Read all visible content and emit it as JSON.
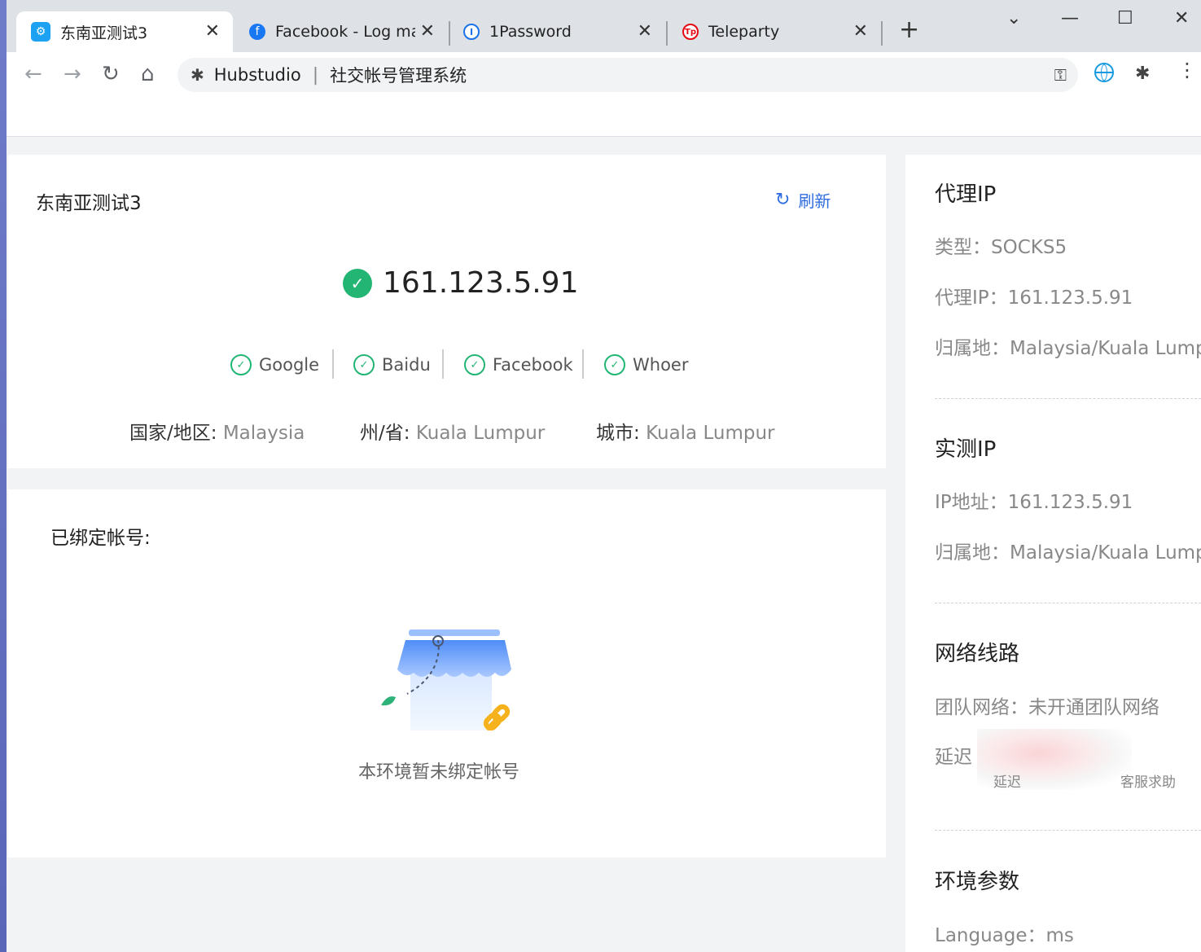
{
  "browser": {
    "tabs": [
      {
        "title": "东南亚测试3",
        "active": true,
        "favicon": "hubstudio-icon",
        "color": "#1da1f2"
      },
      {
        "title": "Facebook - Log ma",
        "active": false,
        "favicon": "facebook-icon",
        "color": "#1877f2"
      },
      {
        "title": "1Password",
        "active": false,
        "favicon": "onepassword-icon",
        "color": "#1a73e8"
      },
      {
        "title": "Teleparty",
        "active": false,
        "favicon": "teleparty-icon",
        "color": "#e50914"
      }
    ],
    "new_tab_glyph": "+",
    "window_controls": {
      "menu": "⌄",
      "minimize": "—",
      "maximize": "☐",
      "close": "✕"
    },
    "omnibox": {
      "site": "Hubstudio",
      "title": "社交帐号管理系统"
    }
  },
  "env": {
    "name": "东南亚测试3",
    "refresh_label": "刷新",
    "ip": "161.123.5.91",
    "sites": [
      "Google",
      "Baidu",
      "Facebook",
      "Whoer"
    ],
    "country_label": "国家/地区:",
    "country": "Malaysia",
    "state_label": "州/省:",
    "state": "Kuala Lumpur",
    "city_label": "城市:",
    "city": "Kuala Lumpur"
  },
  "accounts": {
    "title": "已绑定帐号:",
    "empty_text": "本环境暂未绑定帐号"
  },
  "side": {
    "proxy": {
      "title": "代理IP",
      "type": "类型：SOCKS5",
      "ip": "代理IP：161.123.5.91",
      "location": "归属地：Malaysia/Kuala Lumpur"
    },
    "real": {
      "title": "实测IP",
      "ip": "IP地址：161.123.5.91",
      "location": "归属地：Malaysia/Kuala Lumpur"
    },
    "network": {
      "title": "网络线路",
      "team": "团队网络：未开通团队网络",
      "latency": "延迟",
      "hint_left": "延迟",
      "hint_right": "客服求助"
    },
    "params": {
      "title": "环境参数",
      "language": "Language：ms"
    }
  },
  "colors": {
    "accent": "#2d6cdf",
    "success": "#22b573"
  }
}
